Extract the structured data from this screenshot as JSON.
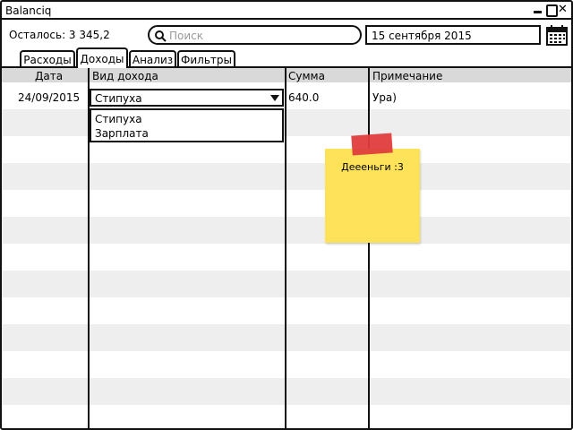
{
  "window": {
    "title": "Balanciq",
    "close_glyph": "✕"
  },
  "header": {
    "remaining_label": "Осталось: 3 345,2",
    "search_placeholder": "Поиск",
    "search_value": "",
    "date_value": "15 сентября 2015"
  },
  "tabs": [
    {
      "label": "Расходы",
      "active": false
    },
    {
      "label": "Доходы",
      "active": true
    },
    {
      "label": "Анализ",
      "active": false
    },
    {
      "label": "Фильтры",
      "active": false
    }
  ],
  "table": {
    "columns": [
      "Дата",
      "Вид дохода",
      "Сумма",
      "Примечание"
    ],
    "rows": [
      {
        "date": "24/09/2015",
        "kind": "Стипуха",
        "amount": "640.0",
        "note": "Ура)"
      }
    ]
  },
  "dropdown": {
    "options": [
      "Стипуха",
      "Зарплата"
    ]
  },
  "sticky_note": {
    "text": "Деееньги :3",
    "color": "#fde25a",
    "tape_color": "#e03c3c"
  },
  "icons": {
    "search": "search-icon",
    "calendar": "calendar-icon",
    "dropdown_arrow": "triangle-down-icon",
    "minimize": "minimize-icon",
    "maximize": "maximize-icon",
    "close": "close-icon"
  },
  "colors": {
    "header_bg": "#d9d9d9",
    "stripe_bg": "#eeeeee",
    "border": "#111111"
  }
}
